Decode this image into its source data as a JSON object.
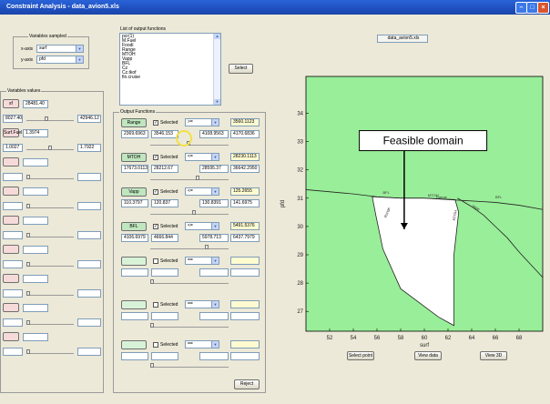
{
  "window": {
    "title": "Constraint Analysis - data_avion5.xls"
  },
  "variables_sampled": {
    "title": "Variables sampled",
    "x_label": "x-axis",
    "x_value": "surf",
    "y_label": "y-axis",
    "y_value": "pfd"
  },
  "variable_values": {
    "title": "Variables values",
    "rows": [
      {
        "name": "sf",
        "value": "28481.40",
        "min": "8027.40",
        "max": "42946.12"
      },
      {
        "name": "Surf.Fuel",
        "value": "1.3974",
        "min": "1.0027",
        "max": "1.7922"
      }
    ]
  },
  "output_list": {
    "title": "List of output functions",
    "items": [
      "pcr(1)",
      "M.Fuel",
      "Foodi",
      "Range",
      "MTOH",
      "Vapp",
      "BFL",
      "Cz",
      "Cz.tkof",
      "fin.cruise"
    ],
    "select_label": "Select"
  },
  "output_functions": {
    "title": "Output Functions",
    "selected_label": "Selected",
    "rows": [
      {
        "name": "Range",
        "op": ">=",
        "threshold": "3560.1123",
        "lo": "2369.6963",
        "val": "3546.153",
        "hi": "4108.9563",
        "max": "4170.6836"
      },
      {
        "name": "MTOH",
        "op": "<=",
        "threshold": "28230.1113",
        "lo": "17673.0113",
        "val": "28212.67",
        "hi": "28595.37",
        "max": "36642.2950"
      },
      {
        "name": "Vapp",
        "op": "<=",
        "threshold": "125.2655",
        "lo": "110.3797",
        "val": "120.837",
        "hi": "130.8391",
        "max": "141.6975"
      },
      {
        "name": "BFL",
        "op": "<=",
        "threshold": "5491.5376",
        "lo": "4106.6979",
        "val": "4666.844",
        "hi": "5978.713",
        "max": "6437.7979"
      }
    ],
    "empty_op": "==",
    "reject_label": "Reject"
  },
  "plot": {
    "file_label": "data_avion5.xls",
    "xlabel": "surf",
    "ylabel": "pfd",
    "annotation": "Feasible domain",
    "curve_labels": [
      "BFL",
      "MTOH",
      "Range",
      "Vapp",
      "Range",
      "MTOH",
      "BFL"
    ],
    "colors": {
      "infeasible": "#99ee99",
      "feasible": "#ffffff"
    },
    "buttons": {
      "select_point": "Select point",
      "view_data": "View data",
      "view_3d": "View 3D"
    }
  },
  "chart_data": {
    "type": "area",
    "xlabel": "surf",
    "ylabel": "pfd",
    "xlim": [
      50,
      70
    ],
    "ylim": [
      26.3,
      35.3
    ],
    "xticks": [
      52,
      54,
      56,
      58,
      60,
      62,
      64,
      66,
      68
    ],
    "yticks": [
      27,
      28,
      29,
      30,
      31,
      32,
      33,
      34
    ],
    "series": [
      {
        "name": "BFL",
        "x": [
          50,
          54,
          56,
          58,
          60,
          62,
          64,
          66,
          68,
          70
        ],
        "y": [
          31.3,
          31.15,
          31.05,
          31.0,
          31.0,
          30.95,
          30.9,
          30.85,
          30.75,
          30.6
        ]
      },
      {
        "name": "Vapp",
        "x": [
          62.8,
          64,
          65,
          66,
          67,
          68,
          70
        ],
        "y": [
          31.0,
          30.7,
          30.4,
          30.0,
          29.6,
          29.1,
          28.2
        ]
      }
    ],
    "feasible_region_x": [
      55.6,
      58,
      60,
      62.6,
      62.9,
      62.5,
      62.5,
      61.2,
      58,
      56.5,
      55.9
    ],
    "feasible_region_y": [
      31.05,
      31.0,
      31.0,
      30.95,
      30.5,
      29.0,
      26.5,
      26.8,
      27.8,
      29.2,
      30.4
    ]
  }
}
